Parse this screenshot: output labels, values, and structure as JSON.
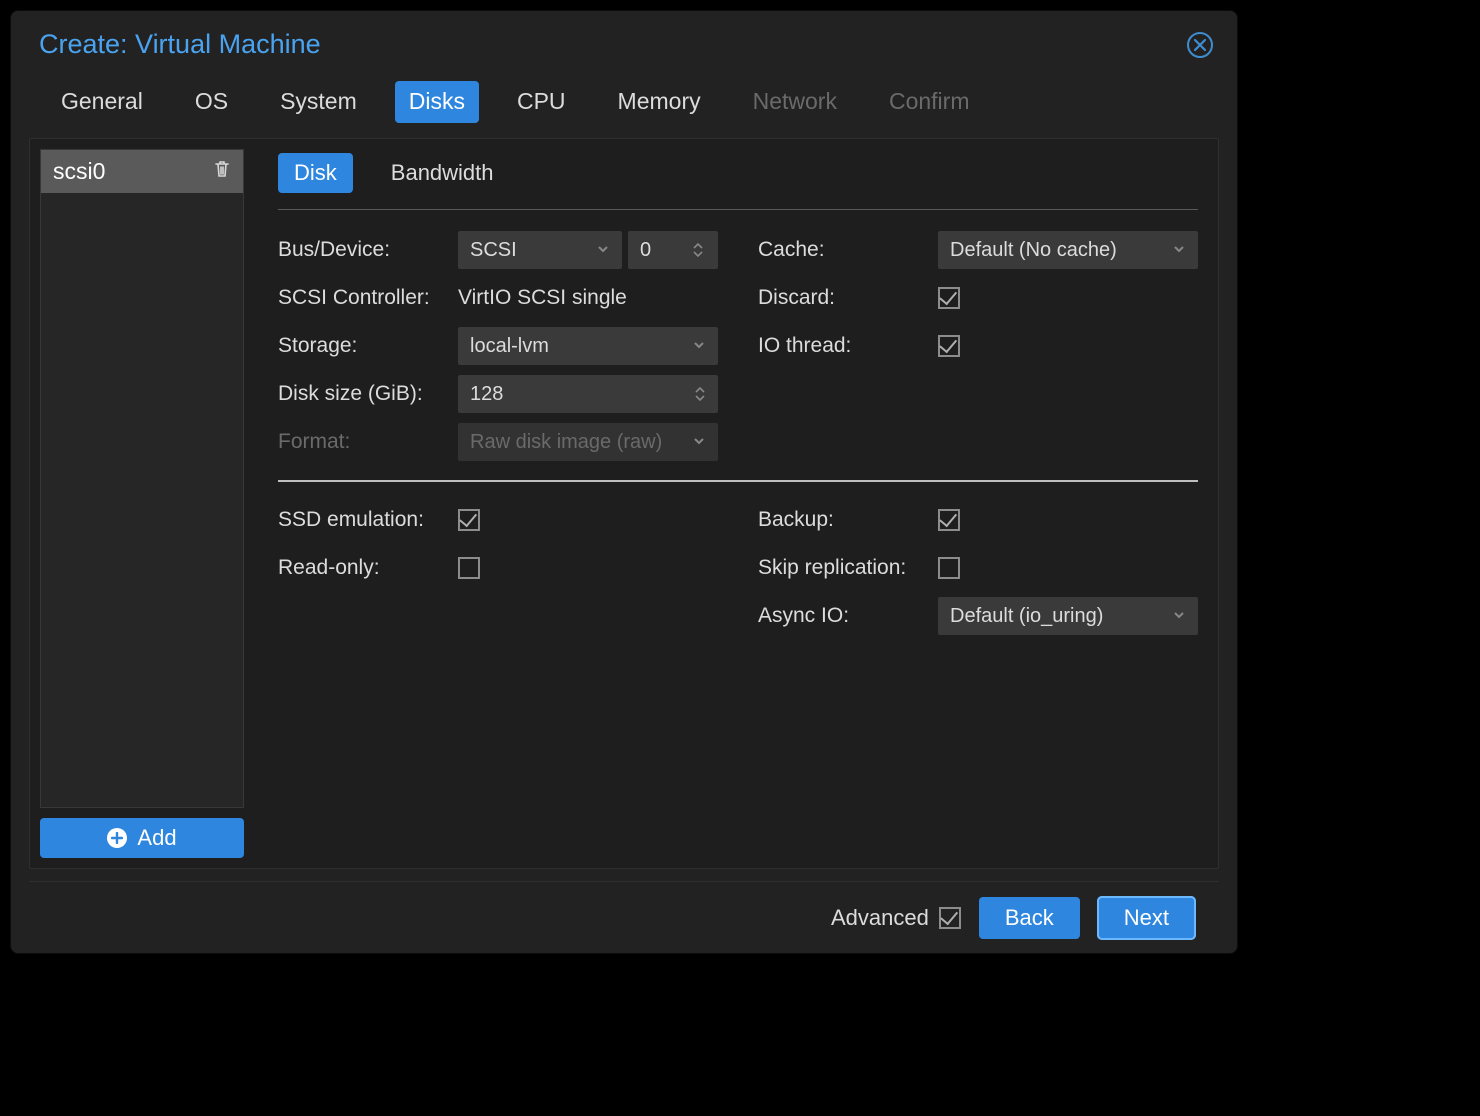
{
  "window": {
    "title": "Create: Virtual Machine"
  },
  "tabs": [
    {
      "label": "General",
      "state": "enabled"
    },
    {
      "label": "OS",
      "state": "enabled"
    },
    {
      "label": "System",
      "state": "enabled"
    },
    {
      "label": "Disks",
      "state": "active"
    },
    {
      "label": "CPU",
      "state": "enabled"
    },
    {
      "label": "Memory",
      "state": "enabled"
    },
    {
      "label": "Network",
      "state": "disabled"
    },
    {
      "label": "Confirm",
      "state": "disabled"
    }
  ],
  "sidebar": {
    "items": [
      {
        "label": "scsi0",
        "selected": true
      }
    ],
    "add_label": "Add"
  },
  "subtabs": [
    {
      "label": "Disk",
      "active": true
    },
    {
      "label": "Bandwidth",
      "active": false
    }
  ],
  "form": {
    "bus_device": {
      "label": "Bus/Device:",
      "bus": "SCSI",
      "index": "0"
    },
    "scsi_controller": {
      "label": "SCSI Controller:",
      "value": "VirtIO SCSI single"
    },
    "storage": {
      "label": "Storage:",
      "value": "local-lvm"
    },
    "disk_size": {
      "label": "Disk size (GiB):",
      "value": "128"
    },
    "format": {
      "label": "Format:",
      "value": "Raw disk image (raw)",
      "disabled": true
    },
    "cache": {
      "label": "Cache:",
      "value": "Default (No cache)"
    },
    "discard": {
      "label": "Discard:",
      "checked": true
    },
    "iothread": {
      "label": "IO thread:",
      "checked": true
    },
    "ssd_emulation": {
      "label": "SSD emulation:",
      "checked": true
    },
    "read_only": {
      "label": "Read-only:",
      "checked": false
    },
    "backup": {
      "label": "Backup:",
      "checked": true
    },
    "skip_replication": {
      "label": "Skip replication:",
      "checked": false
    },
    "async_io": {
      "label": "Async IO:",
      "value": "Default (io_uring)"
    }
  },
  "footer": {
    "advanced_label": "Advanced",
    "advanced_checked": true,
    "back_label": "Back",
    "next_label": "Next"
  }
}
